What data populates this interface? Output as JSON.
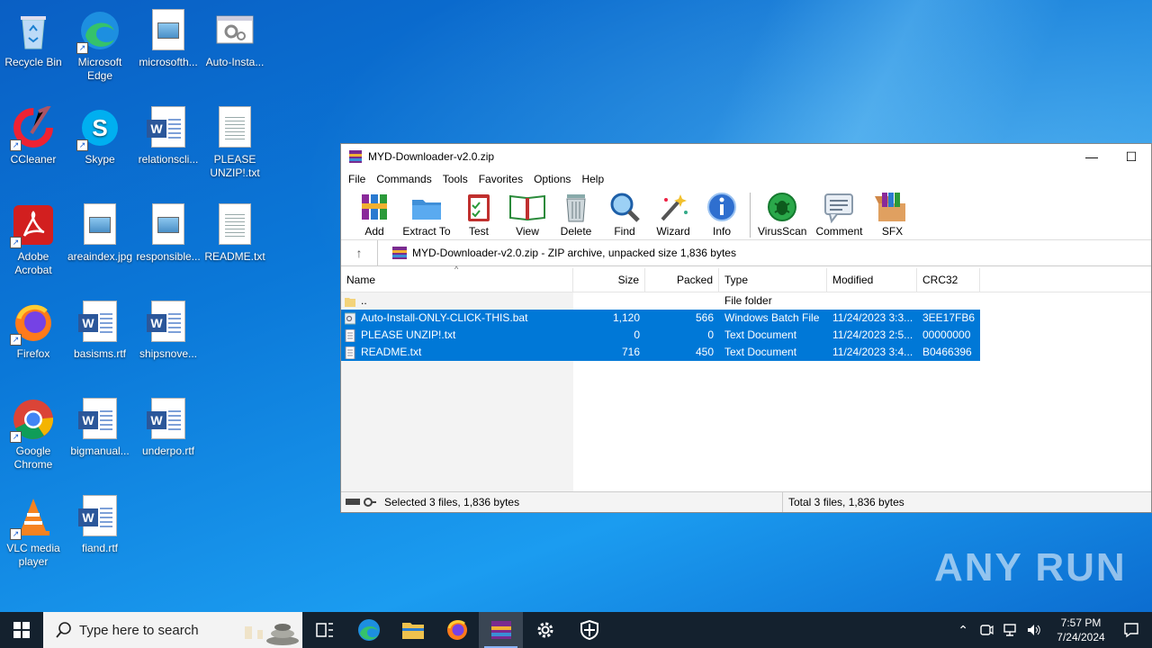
{
  "desktop": {
    "icons": [
      {
        "label": "Recycle Bin",
        "icon": "recycle-bin-icon"
      },
      {
        "label": "Microsoft Edge",
        "icon": "edge-icon"
      },
      {
        "label": "microsofth...",
        "icon": "image-file-icon"
      },
      {
        "label": "Auto-Insta...",
        "icon": "batch-file-icon"
      },
      {
        "label": "CCleaner",
        "icon": "ccleaner-icon"
      },
      {
        "label": "Skype",
        "icon": "skype-icon"
      },
      {
        "label": "relationscli...",
        "icon": "word-doc-icon"
      },
      {
        "label": "PLEASE UNZIP!.txt",
        "icon": "text-file-icon"
      },
      {
        "label": "Adobe Acrobat",
        "icon": "acrobat-icon"
      },
      {
        "label": "areaindex.jpg",
        "icon": "image-file-icon"
      },
      {
        "label": "responsible...",
        "icon": "image-file-icon"
      },
      {
        "label": "README.txt",
        "icon": "text-file-icon"
      },
      {
        "label": "Firefox",
        "icon": "firefox-icon"
      },
      {
        "label": "basisms.rtf",
        "icon": "word-doc-icon"
      },
      {
        "label": "shipsnove...",
        "icon": "word-doc-icon"
      },
      {
        "label": "Google Chrome",
        "icon": "chrome-icon"
      },
      {
        "label": "bigmanual...",
        "icon": "word-doc-icon"
      },
      {
        "label": "underpo.rtf",
        "icon": "word-doc-icon"
      },
      {
        "label": "VLC media player",
        "icon": "vlc-icon"
      },
      {
        "label": "fiand.rtf",
        "icon": "word-doc-icon"
      }
    ]
  },
  "window": {
    "title": "MYD-Downloader-v2.0.zip",
    "menu": [
      "File",
      "Commands",
      "Tools",
      "Favorites",
      "Options",
      "Help"
    ],
    "toolbar": [
      "Add",
      "Extract To",
      "Test",
      "View",
      "Delete",
      "Find",
      "Wizard",
      "Info",
      "VirusScan",
      "Comment",
      "SFX"
    ],
    "path": "MYD-Downloader-v2.0.zip - ZIP archive, unpacked size 1,836 bytes",
    "columns": {
      "name": "Name",
      "size": "Size",
      "packed": "Packed",
      "type": "Type",
      "modified": "Modified",
      "crc": "CRC32"
    },
    "rows": [
      {
        "name": "..",
        "size": "",
        "packed": "",
        "type": "File folder",
        "modified": "",
        "crc": "",
        "icon": "folder-icon",
        "selected": false
      },
      {
        "name": "Auto-Install-ONLY-CLICK-THIS.bat",
        "size": "1,120",
        "packed": "566",
        "type": "Windows Batch File",
        "modified": "11/24/2023 3:3...",
        "crc": "3EE17FB6",
        "icon": "batch-file-icon",
        "selected": true
      },
      {
        "name": "PLEASE UNZIP!.txt",
        "size": "0",
        "packed": "0",
        "type": "Text Document",
        "modified": "11/24/2023 2:5...",
        "crc": "00000000",
        "icon": "text-file-icon",
        "selected": true
      },
      {
        "name": "README.txt",
        "size": "716",
        "packed": "450",
        "type": "Text Document",
        "modified": "11/24/2023 3:4...",
        "crc": "B0466396",
        "icon": "text-file-icon",
        "selected": true
      }
    ],
    "status_left": "Selected 3 files, 1,836 bytes",
    "status_right": "Total 3 files, 1,836 bytes"
  },
  "watermark": "ANY RUN",
  "taskbar": {
    "search_placeholder": "Type here to search",
    "time": "7:57 PM",
    "date": "7/24/2024"
  }
}
